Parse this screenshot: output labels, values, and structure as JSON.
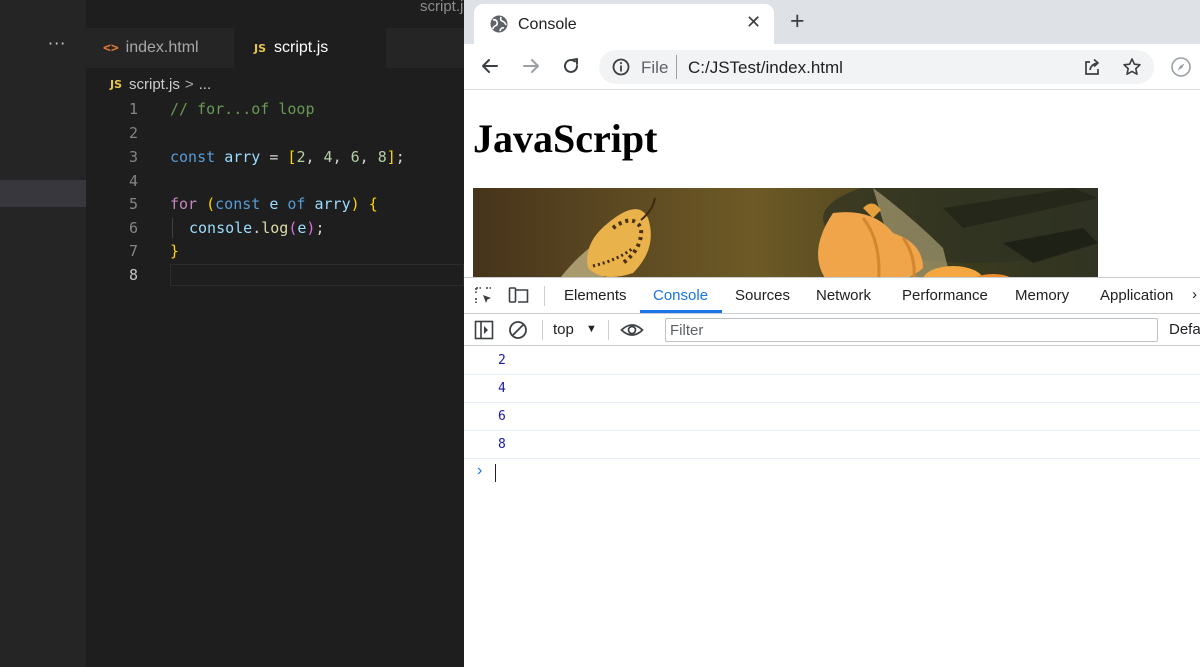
{
  "editor": {
    "title_fragment": "script.j",
    "more_actions": "···",
    "tabs": [
      {
        "label": "index.html",
        "icon": "html-file-icon"
      },
      {
        "label": "script.js",
        "icon": "js-file-icon",
        "active": true
      }
    ],
    "tab_close": "✕",
    "js_badge": "JS",
    "html_badge": "<>",
    "breadcrumb": {
      "file": "script.js",
      "separator": ">",
      "rest": "..."
    },
    "line_numbers": [
      "1",
      "2",
      "3",
      "4",
      "5",
      "6",
      "7",
      "8"
    ],
    "active_line": "8",
    "code": {
      "line1": {
        "comment": "// for...of loop"
      },
      "line3": {
        "kw": "const",
        "var": "arry",
        "eq": " = ",
        "open": "[",
        "n1": "2",
        "c1": ", ",
        "n2": "4",
        "c2": ", ",
        "n3": "6",
        "c3": ", ",
        "n4": "8",
        "close": "]",
        "semi": ";"
      },
      "line5": {
        "kw_for": "for",
        "sp1": " ",
        "open": "(",
        "kw_const": "const",
        "var_e": " e ",
        "kw_of": "of",
        "sp2": " ",
        "var_arry": "arry",
        "close": ")",
        "sp3": " ",
        "brace": "{"
      },
      "line6": {
        "obj": "console",
        "dot": ".",
        "fn": "log",
        "open": "(",
        "arg": "e",
        "close": ")",
        "semi": ";"
      },
      "line7": {
        "brace": "}"
      }
    },
    "colors": {
      "background": "#1e1e1e",
      "comment": "#6a9955",
      "keyword": "#569cd6",
      "variable": "#9cdcfe",
      "number": "#b5cea8",
      "function": "#dcdcaa"
    }
  },
  "browser": {
    "tab": {
      "title": "Console",
      "close": "✕",
      "icon": "globe-icon"
    },
    "new_tab": "+",
    "nav": {
      "back_icon": "arrow-left-icon",
      "forward_icon": "arrow-right-icon",
      "reload_icon": "reload-icon"
    },
    "address": {
      "scheme_label": "File",
      "url": "C:/JSTest/index.html"
    },
    "page": {
      "heading": "JavaScript",
      "image": "butterfly-image"
    },
    "devtools": {
      "tabs": [
        "Elements",
        "Console",
        "Sources",
        "Network",
        "Performance",
        "Memory",
        "Application"
      ],
      "active_tab": "Console",
      "overflow": "›",
      "context": "top",
      "filter_placeholder": "Filter",
      "levels_label": "Default levels",
      "output": [
        "2",
        "4",
        "6",
        "8"
      ],
      "prompt": "›"
    },
    "colors": {
      "accent": "#1a73e8",
      "tabstrip": "#dee1e6",
      "log_number": "#1a1aa6"
    }
  }
}
